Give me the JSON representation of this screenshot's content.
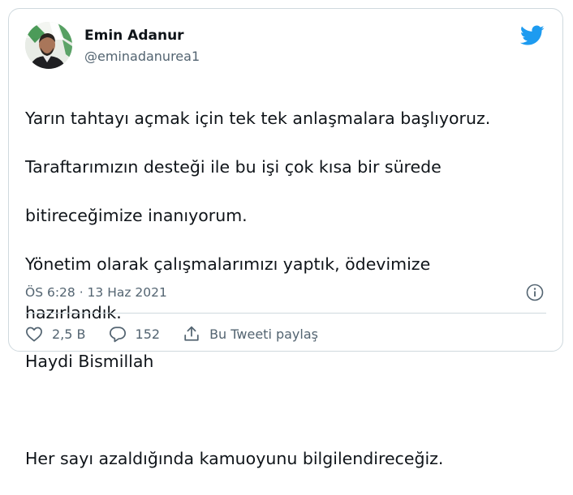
{
  "author": {
    "name": "Emin Adanur",
    "handle": "@eminadanurea1",
    "avatar_icon": "profile-photo",
    "verified": false
  },
  "brand": {
    "logo_icon": "twitter-bird-icon",
    "color": "#1d9bf0"
  },
  "tweet": {
    "lines": [
      "Yarın tahtayı açmak için tek tek anlaşmalara başlıyoruz.",
      "Taraftarımızın desteği ile bu işi çok kısa bir sürede",
      "bitireceğimize inanıyorum.",
      "Yönetim olarak çalışmalarımızı yaptık, ödevimize",
      "hazırlandık.",
      "Haydi Bismillah",
      "",
      "Her sayı azaldığında kamuoyunu bilgilendireceğiz."
    ],
    "timestamp": "ÖS 6:28 · 13 Haz 2021"
  },
  "actions": {
    "like": {
      "icon": "heart-icon",
      "count": "2,5 B"
    },
    "reply": {
      "icon": "reply-bubble-icon",
      "count": "152"
    },
    "share": {
      "icon": "share-upload-icon",
      "label": "Bu Tweeti paylaş"
    },
    "info": {
      "icon": "info-icon"
    }
  },
  "colors": {
    "text": "#0f1419",
    "secondary": "#536471",
    "border": "#cfd9de"
  }
}
